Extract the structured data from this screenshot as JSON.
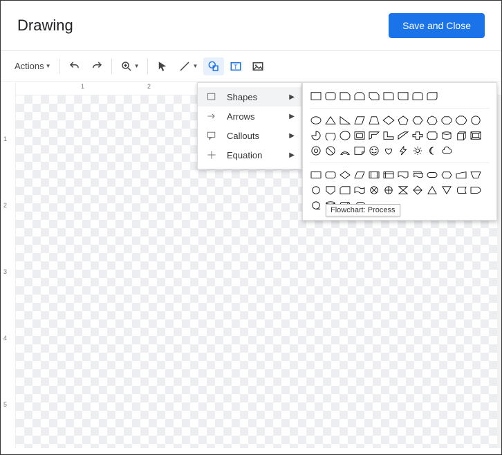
{
  "header": {
    "title": "Drawing",
    "save_label": "Save and Close"
  },
  "toolbar": {
    "actions_label": "Actions"
  },
  "ruler": {
    "marks": [
      "1",
      "2",
      "3",
      "4",
      "5"
    ]
  },
  "menu": {
    "items": [
      {
        "label": "Shapes"
      },
      {
        "label": "Arrows"
      },
      {
        "label": "Callouts"
      },
      {
        "label": "Equation"
      }
    ]
  },
  "tooltip": "Flowchart: Process"
}
